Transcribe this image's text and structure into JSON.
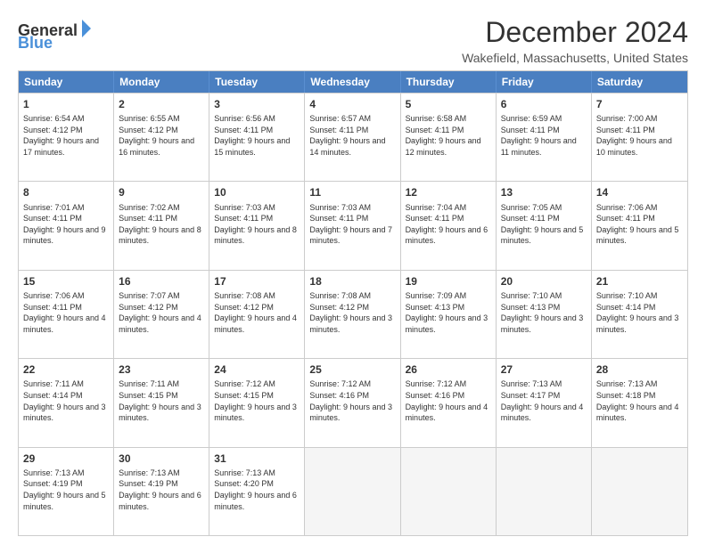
{
  "logo": {
    "general": "General",
    "blue": "Blue"
  },
  "header": {
    "month": "December 2024",
    "location": "Wakefield, Massachusetts, United States"
  },
  "days": [
    "Sunday",
    "Monday",
    "Tuesday",
    "Wednesday",
    "Thursday",
    "Friday",
    "Saturday"
  ],
  "rows": [
    [
      {
        "day": "1",
        "sunrise": "6:54 AM",
        "sunset": "4:12 PM",
        "daylight": "9 hours and 17 minutes."
      },
      {
        "day": "2",
        "sunrise": "6:55 AM",
        "sunset": "4:12 PM",
        "daylight": "9 hours and 16 minutes."
      },
      {
        "day": "3",
        "sunrise": "6:56 AM",
        "sunset": "4:11 PM",
        "daylight": "9 hours and 15 minutes."
      },
      {
        "day": "4",
        "sunrise": "6:57 AM",
        "sunset": "4:11 PM",
        "daylight": "9 hours and 14 minutes."
      },
      {
        "day": "5",
        "sunrise": "6:58 AM",
        "sunset": "4:11 PM",
        "daylight": "9 hours and 12 minutes."
      },
      {
        "day": "6",
        "sunrise": "6:59 AM",
        "sunset": "4:11 PM",
        "daylight": "9 hours and 11 minutes."
      },
      {
        "day": "7",
        "sunrise": "7:00 AM",
        "sunset": "4:11 PM",
        "daylight": "9 hours and 10 minutes."
      }
    ],
    [
      {
        "day": "8",
        "sunrise": "7:01 AM",
        "sunset": "4:11 PM",
        "daylight": "9 hours and 9 minutes."
      },
      {
        "day": "9",
        "sunrise": "7:02 AM",
        "sunset": "4:11 PM",
        "daylight": "9 hours and 8 minutes."
      },
      {
        "day": "10",
        "sunrise": "7:03 AM",
        "sunset": "4:11 PM",
        "daylight": "9 hours and 8 minutes."
      },
      {
        "day": "11",
        "sunrise": "7:03 AM",
        "sunset": "4:11 PM",
        "daylight": "9 hours and 7 minutes."
      },
      {
        "day": "12",
        "sunrise": "7:04 AM",
        "sunset": "4:11 PM",
        "daylight": "9 hours and 6 minutes."
      },
      {
        "day": "13",
        "sunrise": "7:05 AM",
        "sunset": "4:11 PM",
        "daylight": "9 hours and 5 minutes."
      },
      {
        "day": "14",
        "sunrise": "7:06 AM",
        "sunset": "4:11 PM",
        "daylight": "9 hours and 5 minutes."
      }
    ],
    [
      {
        "day": "15",
        "sunrise": "7:06 AM",
        "sunset": "4:11 PM",
        "daylight": "9 hours and 4 minutes."
      },
      {
        "day": "16",
        "sunrise": "7:07 AM",
        "sunset": "4:12 PM",
        "daylight": "9 hours and 4 minutes."
      },
      {
        "day": "17",
        "sunrise": "7:08 AM",
        "sunset": "4:12 PM",
        "daylight": "9 hours and 4 minutes."
      },
      {
        "day": "18",
        "sunrise": "7:08 AM",
        "sunset": "4:12 PM",
        "daylight": "9 hours and 3 minutes."
      },
      {
        "day": "19",
        "sunrise": "7:09 AM",
        "sunset": "4:13 PM",
        "daylight": "9 hours and 3 minutes."
      },
      {
        "day": "20",
        "sunrise": "7:10 AM",
        "sunset": "4:13 PM",
        "daylight": "9 hours and 3 minutes."
      },
      {
        "day": "21",
        "sunrise": "7:10 AM",
        "sunset": "4:14 PM",
        "daylight": "9 hours and 3 minutes."
      }
    ],
    [
      {
        "day": "22",
        "sunrise": "7:11 AM",
        "sunset": "4:14 PM",
        "daylight": "9 hours and 3 minutes."
      },
      {
        "day": "23",
        "sunrise": "7:11 AM",
        "sunset": "4:15 PM",
        "daylight": "9 hours and 3 minutes."
      },
      {
        "day": "24",
        "sunrise": "7:12 AM",
        "sunset": "4:15 PM",
        "daylight": "9 hours and 3 minutes."
      },
      {
        "day": "25",
        "sunrise": "7:12 AM",
        "sunset": "4:16 PM",
        "daylight": "9 hours and 3 minutes."
      },
      {
        "day": "26",
        "sunrise": "7:12 AM",
        "sunset": "4:16 PM",
        "daylight": "9 hours and 4 minutes."
      },
      {
        "day": "27",
        "sunrise": "7:13 AM",
        "sunset": "4:17 PM",
        "daylight": "9 hours and 4 minutes."
      },
      {
        "day": "28",
        "sunrise": "7:13 AM",
        "sunset": "4:18 PM",
        "daylight": "9 hours and 4 minutes."
      }
    ],
    [
      {
        "day": "29",
        "sunrise": "7:13 AM",
        "sunset": "4:19 PM",
        "daylight": "9 hours and 5 minutes."
      },
      {
        "day": "30",
        "sunrise": "7:13 AM",
        "sunset": "4:19 PM",
        "daylight": "9 hours and 6 minutes."
      },
      {
        "day": "31",
        "sunrise": "7:13 AM",
        "sunset": "4:20 PM",
        "daylight": "9 hours and 6 minutes."
      },
      null,
      null,
      null,
      null
    ]
  ]
}
